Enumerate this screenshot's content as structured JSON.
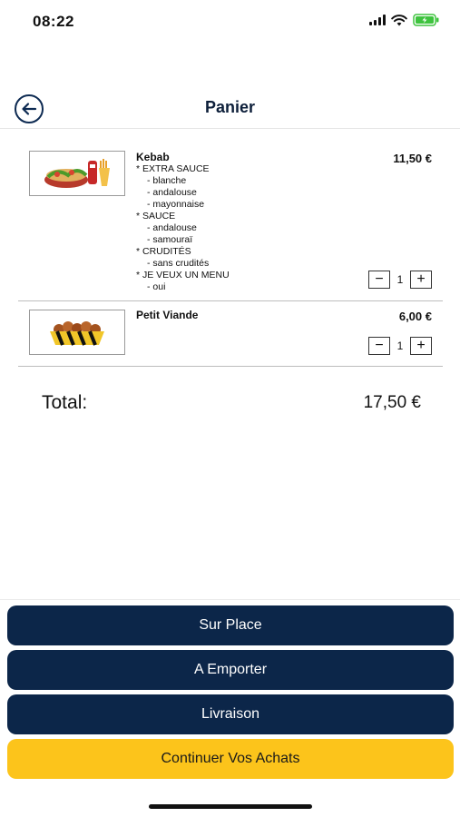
{
  "status": {
    "time": "08:22"
  },
  "header": {
    "title": "Panier",
    "back_icon": "back-arrow-icon"
  },
  "items": [
    {
      "name": "Kebab",
      "price": "11,50 €",
      "image": "kebab-meal-image",
      "options": [
        {
          "group": "* EXTRA SAUCE",
          "choices": [
            "- blanche",
            "- andalouse",
            "- mayonnaise"
          ]
        },
        {
          "group": "* SAUCE",
          "choices": [
            "- andalouse",
            "- samouraï"
          ]
        },
        {
          "group": "* CRUDITÉS",
          "choices": [
            "- sans crudités"
          ]
        },
        {
          "group": "* JE VEUX UN MENU",
          "choices": [
            "- oui"
          ]
        }
      ],
      "quantity": "1"
    },
    {
      "name": "Petit Viande",
      "price": "6,00 €",
      "image": "meat-tray-image",
      "options": [],
      "quantity": "1"
    }
  ],
  "qty_controls": {
    "minus": "−",
    "plus": "+"
  },
  "total": {
    "label": "Total:",
    "value": "17,50 €"
  },
  "actions": {
    "sur_place": "Sur Place",
    "a_emporter": "A Emporter",
    "livraison": "Livraison",
    "continuer": "Continuer Vos Achats"
  },
  "colors": {
    "navy": "#0c2649",
    "yellow": "#fcc41b",
    "battery": "#3ec33e"
  }
}
